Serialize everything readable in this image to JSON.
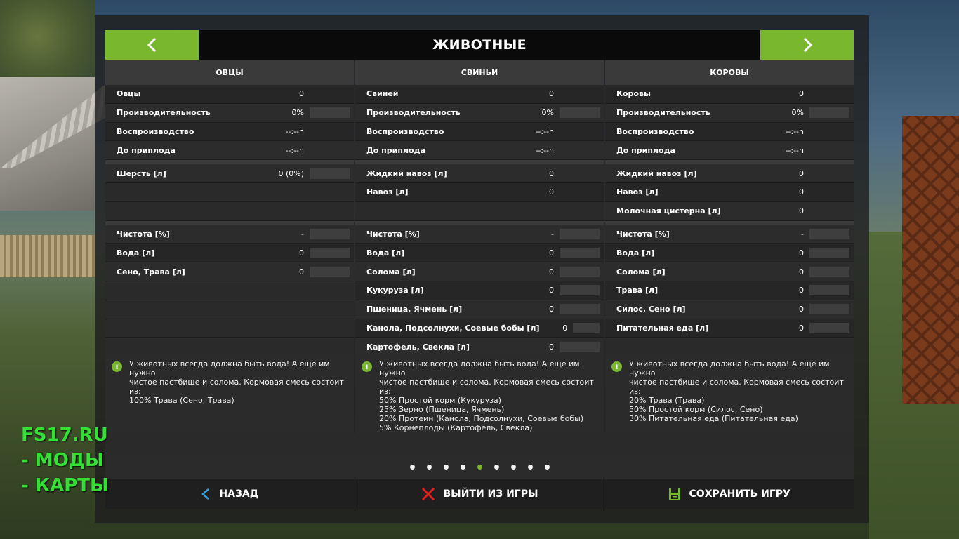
{
  "header": {
    "title": "ЖИВОТНЫЕ",
    "prev_icon": "chevron-left-icon",
    "next_icon": "chevron-right-icon"
  },
  "columns": [
    {
      "title": "ОВЦЫ",
      "group1": [
        {
          "label": "Овцы",
          "value": "0",
          "bar": false
        },
        {
          "label": "Производительность",
          "value": "0%",
          "bar": true
        },
        {
          "label": "Воспроизводство",
          "value": "--:--h",
          "bar": false
        },
        {
          "label": "До приплода",
          "value": "--:--h",
          "bar": false
        }
      ],
      "group2": [
        {
          "label": "Шерсть [л]",
          "value": "0 (0%)",
          "bar": true
        },
        {
          "label": "",
          "value": "",
          "bar": false
        },
        {
          "label": "",
          "value": "",
          "bar": false
        }
      ],
      "group3": [
        {
          "label": "Чистота [%]",
          "value": "-",
          "bar": true
        },
        {
          "label": "Вода [л]",
          "value": "0",
          "bar": true
        },
        {
          "label": "Сено, Трава [л]",
          "value": "0",
          "bar": true
        },
        {
          "label": "",
          "value": "",
          "bar": false
        },
        {
          "label": "",
          "value": "",
          "bar": false
        },
        {
          "label": "",
          "value": "",
          "bar": false
        },
        {
          "label": "",
          "value": "",
          "bar": false
        }
      ],
      "info": "У животных всегда должна быть вода! А еще им нужно\nчистое пастбище и солома. Кормовая смесь состоит\nиз:\n100% Трава (Сено, Трава)"
    },
    {
      "title": "СВИНЬИ",
      "group1": [
        {
          "label": "Свиней",
          "value": "0",
          "bar": false
        },
        {
          "label": "Производительность",
          "value": "0%",
          "bar": true
        },
        {
          "label": "Воспроизводство",
          "value": "--:--h",
          "bar": false
        },
        {
          "label": "До приплода",
          "value": "--:--h",
          "bar": false
        }
      ],
      "group2": [
        {
          "label": "Жидкий навоз [л]",
          "value": "0",
          "bar": false
        },
        {
          "label": "Навоз [л]",
          "value": "0",
          "bar": false
        },
        {
          "label": "",
          "value": "",
          "bar": false
        }
      ],
      "group3": [
        {
          "label": "Чистота [%]",
          "value": "-",
          "bar": true
        },
        {
          "label": "Вода [л]",
          "value": "0",
          "bar": true
        },
        {
          "label": "Солома [л]",
          "value": "0",
          "bar": true
        },
        {
          "label": "Кукуруза [л]",
          "value": "0",
          "bar": true
        },
        {
          "label": "Пшеница, Ячмень [л]",
          "value": "0",
          "bar": true
        },
        {
          "label": "Канола, Подсолнухи, Соевые бобы [л]",
          "value": "0",
          "bar": true
        },
        {
          "label": "Картофель, Свекла [л]",
          "value": "0",
          "bar": true
        }
      ],
      "info": "У животных всегда должна быть вода! А еще им нужно\nчистое пастбище и солома. Кормовая смесь состоит\nиз:\n50% Простой корм (Кукуруза)\n25% Зерно (Пшеница, Ячмень)\n20% Протеин (Канола, Подсолнухи, Соевые бобы)\n5% Корнеплоды (Картофель, Свекла)"
    },
    {
      "title": "КОРОВЫ",
      "group1": [
        {
          "label": "Коровы",
          "value": "0",
          "bar": false
        },
        {
          "label": "Производительность",
          "value": "0%",
          "bar": true
        },
        {
          "label": "Воспроизводство",
          "value": "--:--h",
          "bar": false
        },
        {
          "label": "До приплода",
          "value": "--:--h",
          "bar": false
        }
      ],
      "group2": [
        {
          "label": "Жидкий навоз [л]",
          "value": "0",
          "bar": false
        },
        {
          "label": "Навоз [л]",
          "value": "0",
          "bar": false
        },
        {
          "label": "Молочная цистерна [л]",
          "value": "0",
          "bar": false
        }
      ],
      "group3": [
        {
          "label": "Чистота [%]",
          "value": "-",
          "bar": true
        },
        {
          "label": "Вода [л]",
          "value": "0",
          "bar": true
        },
        {
          "label": "Солома [л]",
          "value": "0",
          "bar": true
        },
        {
          "label": "Трава [л]",
          "value": "0",
          "bar": true
        },
        {
          "label": "Силос, Сено [л]",
          "value": "0",
          "bar": true
        },
        {
          "label": "Питательная еда [л]",
          "value": "0",
          "bar": true
        },
        {
          "label": "",
          "value": "",
          "bar": false
        }
      ],
      "info": "У животных всегда должна быть вода! А еще им нужно\nчистое пастбище и солома. Кормовая смесь состоит\nиз:\n20% Трава (Трава)\n50% Простой корм (Силос, Сено)\n30% Питательная еда (Питательная еда)"
    }
  ],
  "pagination": {
    "count": 9,
    "active_index": 4
  },
  "footer": {
    "back_label": "НАЗАД",
    "exit_label": "ВЫЙТИ ИЗ ИГРЫ",
    "save_label": "СОХРАНИТЬ ИГРУ",
    "back_icon": "chevron-left-icon",
    "exit_icon": "close-icon",
    "save_icon": "floppy-disk-icon"
  },
  "watermark": {
    "text": "FS17.RU\n- МОДЫ\n- КАРТЫ"
  },
  "colors": {
    "accent": "#79b72f",
    "panel": "#2b2b2b",
    "header": "#0a0a0a",
    "watermark": "#33e033"
  }
}
